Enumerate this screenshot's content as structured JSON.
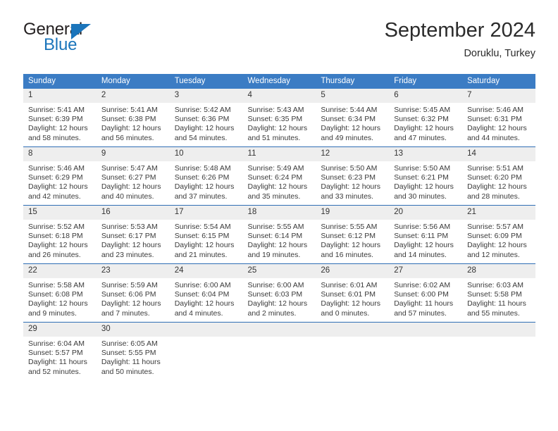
{
  "brand": {
    "name_part1": "General",
    "name_part2": "Blue",
    "triangle_color": "#1b75bb"
  },
  "header": {
    "title": "September 2024",
    "location": "Doruklu, Turkey",
    "accent_color": "#3b7cc4",
    "separator_color": "#2f6eb5",
    "daynum_bg": "#eeeeee"
  },
  "weekday_headers": [
    "Sunday",
    "Monday",
    "Tuesday",
    "Wednesday",
    "Thursday",
    "Friday",
    "Saturday"
  ],
  "weeks": [
    {
      "days": [
        {
          "num": "1",
          "sunrise": "Sunrise: 5:41 AM",
          "sunset": "Sunset: 6:39 PM",
          "daylight_1": "Daylight: 12 hours",
          "daylight_2": "and 58 minutes."
        },
        {
          "num": "2",
          "sunrise": "Sunrise: 5:41 AM",
          "sunset": "Sunset: 6:38 PM",
          "daylight_1": "Daylight: 12 hours",
          "daylight_2": "and 56 minutes."
        },
        {
          "num": "3",
          "sunrise": "Sunrise: 5:42 AM",
          "sunset": "Sunset: 6:36 PM",
          "daylight_1": "Daylight: 12 hours",
          "daylight_2": "and 54 minutes."
        },
        {
          "num": "4",
          "sunrise": "Sunrise: 5:43 AM",
          "sunset": "Sunset: 6:35 PM",
          "daylight_1": "Daylight: 12 hours",
          "daylight_2": "and 51 minutes."
        },
        {
          "num": "5",
          "sunrise": "Sunrise: 5:44 AM",
          "sunset": "Sunset: 6:34 PM",
          "daylight_1": "Daylight: 12 hours",
          "daylight_2": "and 49 minutes."
        },
        {
          "num": "6",
          "sunrise": "Sunrise: 5:45 AM",
          "sunset": "Sunset: 6:32 PM",
          "daylight_1": "Daylight: 12 hours",
          "daylight_2": "and 47 minutes."
        },
        {
          "num": "7",
          "sunrise": "Sunrise: 5:46 AM",
          "sunset": "Sunset: 6:31 PM",
          "daylight_1": "Daylight: 12 hours",
          "daylight_2": "and 44 minutes."
        }
      ]
    },
    {
      "days": [
        {
          "num": "8",
          "sunrise": "Sunrise: 5:46 AM",
          "sunset": "Sunset: 6:29 PM",
          "daylight_1": "Daylight: 12 hours",
          "daylight_2": "and 42 minutes."
        },
        {
          "num": "9",
          "sunrise": "Sunrise: 5:47 AM",
          "sunset": "Sunset: 6:27 PM",
          "daylight_1": "Daylight: 12 hours",
          "daylight_2": "and 40 minutes."
        },
        {
          "num": "10",
          "sunrise": "Sunrise: 5:48 AM",
          "sunset": "Sunset: 6:26 PM",
          "daylight_1": "Daylight: 12 hours",
          "daylight_2": "and 37 minutes."
        },
        {
          "num": "11",
          "sunrise": "Sunrise: 5:49 AM",
          "sunset": "Sunset: 6:24 PM",
          "daylight_1": "Daylight: 12 hours",
          "daylight_2": "and 35 minutes."
        },
        {
          "num": "12",
          "sunrise": "Sunrise: 5:50 AM",
          "sunset": "Sunset: 6:23 PM",
          "daylight_1": "Daylight: 12 hours",
          "daylight_2": "and 33 minutes."
        },
        {
          "num": "13",
          "sunrise": "Sunrise: 5:50 AM",
          "sunset": "Sunset: 6:21 PM",
          "daylight_1": "Daylight: 12 hours",
          "daylight_2": "and 30 minutes."
        },
        {
          "num": "14",
          "sunrise": "Sunrise: 5:51 AM",
          "sunset": "Sunset: 6:20 PM",
          "daylight_1": "Daylight: 12 hours",
          "daylight_2": "and 28 minutes."
        }
      ]
    },
    {
      "days": [
        {
          "num": "15",
          "sunrise": "Sunrise: 5:52 AM",
          "sunset": "Sunset: 6:18 PM",
          "daylight_1": "Daylight: 12 hours",
          "daylight_2": "and 26 minutes."
        },
        {
          "num": "16",
          "sunrise": "Sunrise: 5:53 AM",
          "sunset": "Sunset: 6:17 PM",
          "daylight_1": "Daylight: 12 hours",
          "daylight_2": "and 23 minutes."
        },
        {
          "num": "17",
          "sunrise": "Sunrise: 5:54 AM",
          "sunset": "Sunset: 6:15 PM",
          "daylight_1": "Daylight: 12 hours",
          "daylight_2": "and 21 minutes."
        },
        {
          "num": "18",
          "sunrise": "Sunrise: 5:55 AM",
          "sunset": "Sunset: 6:14 PM",
          "daylight_1": "Daylight: 12 hours",
          "daylight_2": "and 19 minutes."
        },
        {
          "num": "19",
          "sunrise": "Sunrise: 5:55 AM",
          "sunset": "Sunset: 6:12 PM",
          "daylight_1": "Daylight: 12 hours",
          "daylight_2": "and 16 minutes."
        },
        {
          "num": "20",
          "sunrise": "Sunrise: 5:56 AM",
          "sunset": "Sunset: 6:11 PM",
          "daylight_1": "Daylight: 12 hours",
          "daylight_2": "and 14 minutes."
        },
        {
          "num": "21",
          "sunrise": "Sunrise: 5:57 AM",
          "sunset": "Sunset: 6:09 PM",
          "daylight_1": "Daylight: 12 hours",
          "daylight_2": "and 12 minutes."
        }
      ]
    },
    {
      "days": [
        {
          "num": "22",
          "sunrise": "Sunrise: 5:58 AM",
          "sunset": "Sunset: 6:08 PM",
          "daylight_1": "Daylight: 12 hours",
          "daylight_2": "and 9 minutes."
        },
        {
          "num": "23",
          "sunrise": "Sunrise: 5:59 AM",
          "sunset": "Sunset: 6:06 PM",
          "daylight_1": "Daylight: 12 hours",
          "daylight_2": "and 7 minutes."
        },
        {
          "num": "24",
          "sunrise": "Sunrise: 6:00 AM",
          "sunset": "Sunset: 6:04 PM",
          "daylight_1": "Daylight: 12 hours",
          "daylight_2": "and 4 minutes."
        },
        {
          "num": "25",
          "sunrise": "Sunrise: 6:00 AM",
          "sunset": "Sunset: 6:03 PM",
          "daylight_1": "Daylight: 12 hours",
          "daylight_2": "and 2 minutes."
        },
        {
          "num": "26",
          "sunrise": "Sunrise: 6:01 AM",
          "sunset": "Sunset: 6:01 PM",
          "daylight_1": "Daylight: 12 hours",
          "daylight_2": "and 0 minutes."
        },
        {
          "num": "27",
          "sunrise": "Sunrise: 6:02 AM",
          "sunset": "Sunset: 6:00 PM",
          "daylight_1": "Daylight: 11 hours",
          "daylight_2": "and 57 minutes."
        },
        {
          "num": "28",
          "sunrise": "Sunrise: 6:03 AM",
          "sunset": "Sunset: 5:58 PM",
          "daylight_1": "Daylight: 11 hours",
          "daylight_2": "and 55 minutes."
        }
      ]
    },
    {
      "days": [
        {
          "num": "29",
          "sunrise": "Sunrise: 6:04 AM",
          "sunset": "Sunset: 5:57 PM",
          "daylight_1": "Daylight: 11 hours",
          "daylight_2": "and 52 minutes."
        },
        {
          "num": "30",
          "sunrise": "Sunrise: 6:05 AM",
          "sunset": "Sunset: 5:55 PM",
          "daylight_1": "Daylight: 11 hours",
          "daylight_2": "and 50 minutes."
        },
        {
          "num": "",
          "sunrise": "",
          "sunset": "",
          "daylight_1": "",
          "daylight_2": ""
        },
        {
          "num": "",
          "sunrise": "",
          "sunset": "",
          "daylight_1": "",
          "daylight_2": ""
        },
        {
          "num": "",
          "sunrise": "",
          "sunset": "",
          "daylight_1": "",
          "daylight_2": ""
        },
        {
          "num": "",
          "sunrise": "",
          "sunset": "",
          "daylight_1": "",
          "daylight_2": ""
        },
        {
          "num": "",
          "sunrise": "",
          "sunset": "",
          "daylight_1": "",
          "daylight_2": ""
        }
      ]
    }
  ]
}
